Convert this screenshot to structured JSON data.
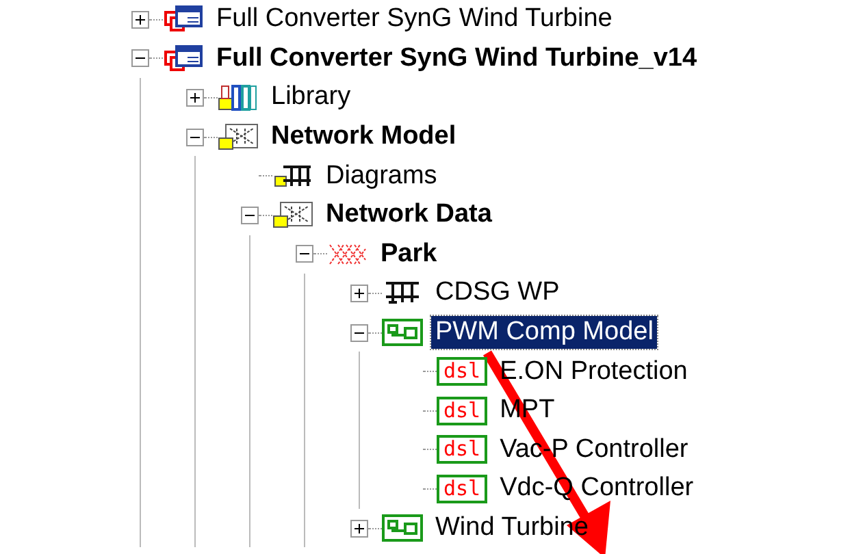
{
  "tree": [
    {
      "label": "Full Converter SynG Wind Turbine",
      "kind": "project",
      "expanded": false,
      "bold": false,
      "selected": false
    },
    {
      "label": "Full Converter SynG Wind Turbine_v14",
      "kind": "project",
      "expanded": true,
      "bold": true,
      "selected": false,
      "children": [
        {
          "label": "Library",
          "kind": "library",
          "expanded": false,
          "bold": false,
          "selected": false
        },
        {
          "label": "Network Model",
          "kind": "netmodel",
          "expanded": true,
          "bold": true,
          "selected": false,
          "children": [
            {
              "label": "Diagrams",
              "kind": "diagrams",
              "bold": false,
              "selected": false
            },
            {
              "label": "Network Data",
              "kind": "netmodel",
              "expanded": true,
              "bold": true,
              "selected": false,
              "children": [
                {
                  "label": "Park",
                  "kind": "park",
                  "expanded": true,
                  "bold": true,
                  "selected": false,
                  "children": [
                    {
                      "label": "CDSG WP",
                      "kind": "grid",
                      "expanded": false,
                      "bold": false,
                      "selected": false
                    },
                    {
                      "label": "PWM Comp Model",
                      "kind": "composite",
                      "expanded": true,
                      "bold": false,
                      "selected": true,
                      "children": [
                        {
                          "label": "E.ON Protection",
                          "kind": "dsl",
                          "badge": "dsl",
                          "bold": false,
                          "selected": false
                        },
                        {
                          "label": "MPT",
                          "kind": "dsl",
                          "badge": "dsl",
                          "bold": false,
                          "selected": false
                        },
                        {
                          "label": "Vac-P Controller",
                          "kind": "dsl",
                          "badge": "dsl",
                          "bold": false,
                          "selected": false
                        },
                        {
                          "label": "Vdc-Q Controller",
                          "kind": "dsl",
                          "badge": "dsl",
                          "bold": false,
                          "selected": false
                        }
                      ]
                    },
                    {
                      "label": "Wind Turbine",
                      "kind": "composite",
                      "expanded": false,
                      "bold": false,
                      "selected": false
                    }
                  ]
                }
              ]
            }
          ]
        }
      ]
    }
  ]
}
